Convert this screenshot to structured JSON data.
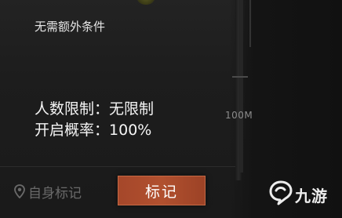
{
  "panel": {
    "condition_text": "无需额外条件",
    "player_limit_label": "人数限制：",
    "player_limit_value": "无限制",
    "open_chance_label": "开启概率：",
    "open_chance_value": "100%"
  },
  "map": {
    "scale_text": "100M"
  },
  "bottom_bar": {
    "self_mark_label": "自身标记",
    "mark_button_label": "标记"
  },
  "watermark": {
    "text": "九游"
  },
  "colors": {
    "button_accent": "#a5472a",
    "text_primary": "#f5f5f5",
    "text_dim": "#6a6a6a"
  },
  "icons": {
    "self_mark": "location-pin-icon",
    "watermark": "jiuyou-logo-icon"
  }
}
